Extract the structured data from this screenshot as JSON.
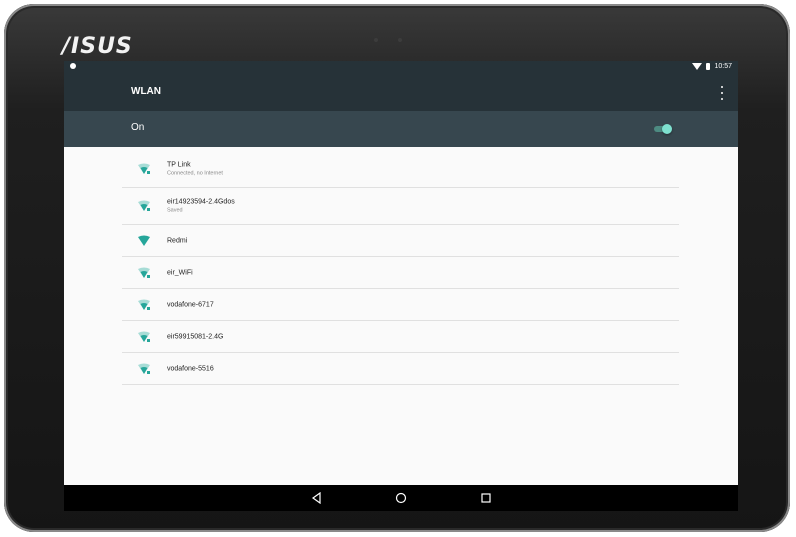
{
  "device": {
    "brand": "/ISUS"
  },
  "status_bar": {
    "time": "10:57"
  },
  "app_bar": {
    "title": "WLAN"
  },
  "master_toggle": {
    "label": "On",
    "enabled": true
  },
  "networks": [
    {
      "name": "TP Link",
      "status": "Connected, no Internet",
      "secured": true
    },
    {
      "name": "eir14923594-2.4Gdos",
      "status": "Saved",
      "secured": true
    },
    {
      "name": "Redmi",
      "status": "",
      "secured": false
    },
    {
      "name": "eir_WiFi",
      "status": "",
      "secured": true
    },
    {
      "name": "vodafone-6717",
      "status": "",
      "secured": true
    },
    {
      "name": "eir59915081-2.4G",
      "status": "",
      "secured": true
    },
    {
      "name": "vodafone-5516",
      "status": "",
      "secured": true
    }
  ],
  "colors": {
    "accent": "#26a69a",
    "app_bar": "#263238",
    "toggle_bar": "#37474f"
  },
  "icons": {
    "wifi": "wifi-icon",
    "back": "back-icon",
    "home": "home-icon",
    "recents": "recents-icon",
    "overflow": "more-vert-icon"
  }
}
